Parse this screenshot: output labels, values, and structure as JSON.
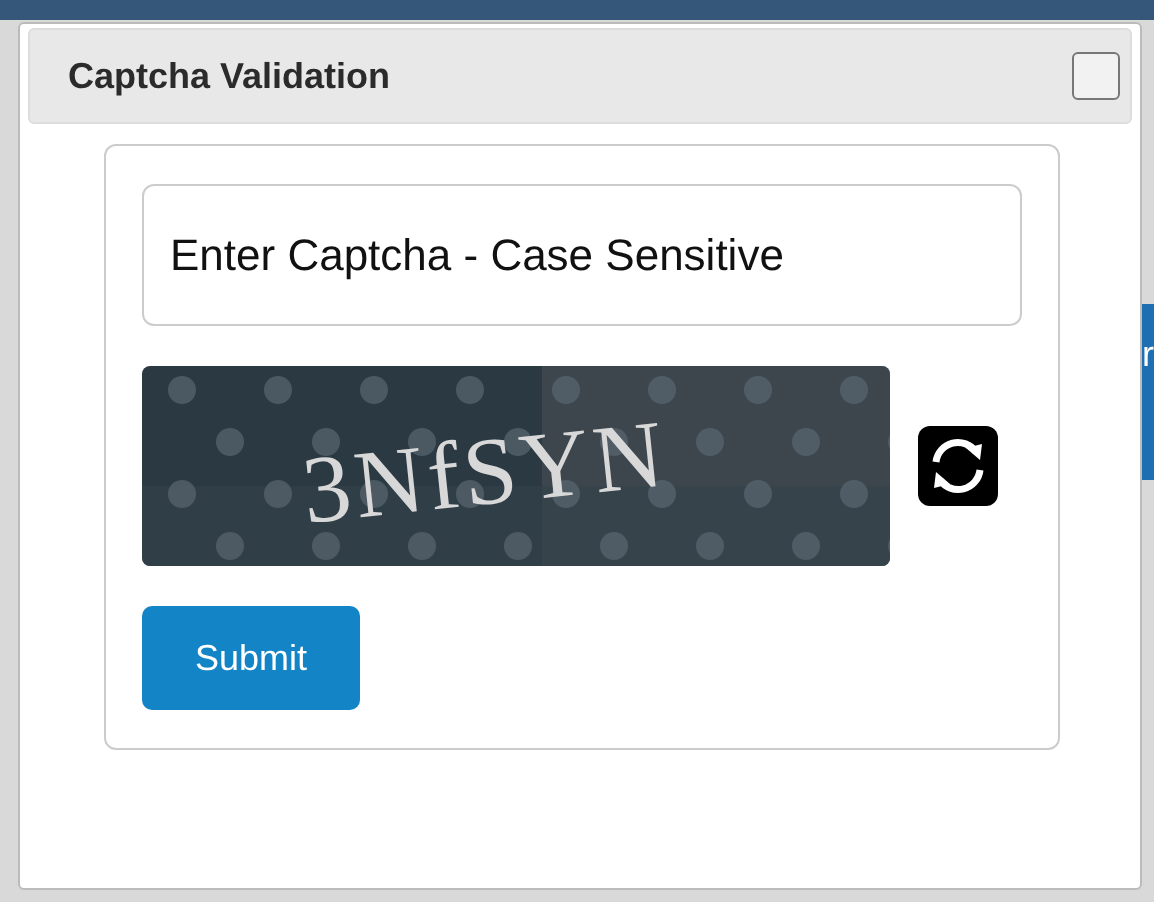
{
  "background_page": {
    "right_fragment": "r"
  },
  "dialog": {
    "title": "Captcha Validation",
    "close_checked": false,
    "captcha_field": {
      "placeholder": "Enter Captcha - Case Sensitive"
    },
    "captcha_image": {
      "kind": "picture",
      "text": "3NfSYN"
    },
    "submit_label": "Submit"
  }
}
